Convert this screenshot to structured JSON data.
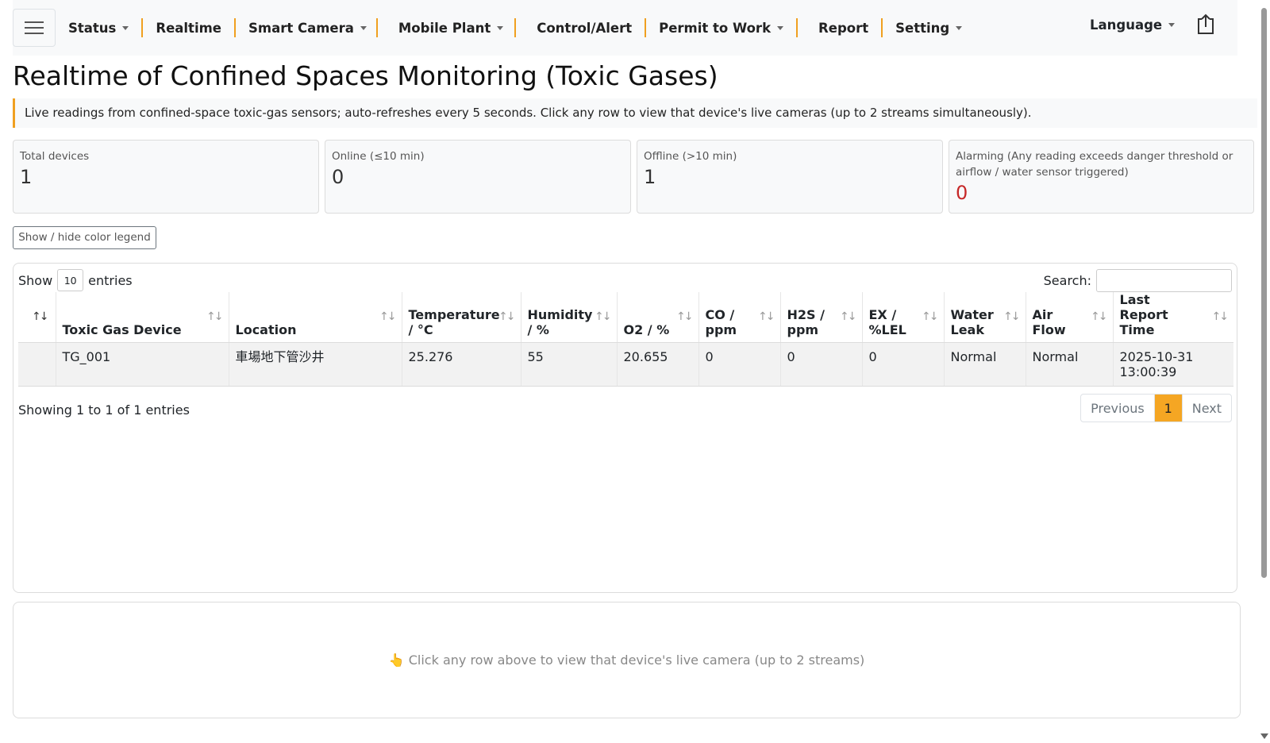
{
  "navbar": {
    "items": [
      {
        "label": "Status",
        "dropdown": true
      },
      {
        "label": "Realtime",
        "dropdown": false
      },
      {
        "label": "Smart Camera",
        "dropdown": true
      },
      {
        "label": "Mobile Plant",
        "dropdown": true
      },
      {
        "label": "Control/Alert",
        "dropdown": false
      },
      {
        "label": "Permit to Work",
        "dropdown": true
      },
      {
        "label": "Report",
        "dropdown": false
      },
      {
        "label": "Setting",
        "dropdown": true
      }
    ],
    "language_label": "Language",
    "accent_color": "#f0a020"
  },
  "page": {
    "title": "Realtime of Confined Spaces Monitoring (Toxic Gases)",
    "info": "Live readings from confined-space toxic-gas sensors; auto-refreshes every 5 seconds. Click any row to view that device's live cameras (up to 2 streams simultaneously)."
  },
  "cards": [
    {
      "label": "Total devices",
      "value": "1"
    },
    {
      "label": "Online (≤10 min)",
      "value": "0"
    },
    {
      "label": "Offline (>10 min)",
      "value": "1"
    },
    {
      "label": "Alarming (Any reading exceeds danger threshold or airflow / water sensor triggered)",
      "value": "0",
      "color": "#c62828"
    }
  ],
  "legend_button": "Show / hide color legend",
  "table": {
    "show_label": "Show",
    "entries_value": "10",
    "entries_label": "entries",
    "search_label": "Search:",
    "search_value": "",
    "columns": [
      "",
      "Toxic Gas Device",
      "Location",
      "Temperature / °C",
      "Humidity / %",
      "O2 / %",
      "CO / ppm",
      "H2S / ppm",
      "EX / %LEL",
      "Water Leak",
      "Air Flow",
      "Last Report Time"
    ],
    "rows": [
      [
        "",
        "TG_001",
        "車場地下管沙井",
        "25.276",
        "55",
        "20.655",
        "0",
        "0",
        "0",
        "Normal",
        "Normal",
        "2025-10-31 13:00:39"
      ]
    ],
    "showing_text": "Showing 1 to 1 of 1 entries",
    "pager": {
      "prev": "Previous",
      "current": "1",
      "next": "Next"
    },
    "active_page_color": "#f5a623"
  },
  "camera_panel": {
    "icon": "pointing-hand-icon",
    "message": "👆 Click any row above to view that device's live camera (up to 2 streams)"
  }
}
